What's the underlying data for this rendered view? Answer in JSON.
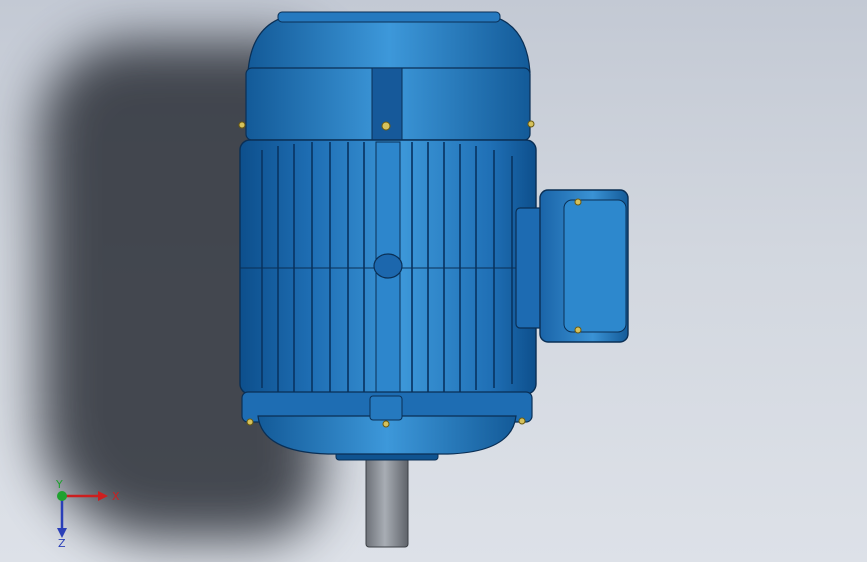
{
  "viewport": {
    "background_top": "#c3c9d4",
    "background_bottom": "#dde1e8"
  },
  "model": {
    "description_icon": "electric-motor-3d-model",
    "body_color": "#1f6fb5",
    "body_highlight": "#3c97d8",
    "body_dark": "#0d4f8c",
    "shaft_color": "#8a8f96"
  },
  "triad": {
    "x_label": "X",
    "y_label": "Y",
    "z_label": "Z",
    "x_color": "#cc1f1f",
    "y_color": "#1fa12f",
    "z_color": "#2a3fb8"
  }
}
